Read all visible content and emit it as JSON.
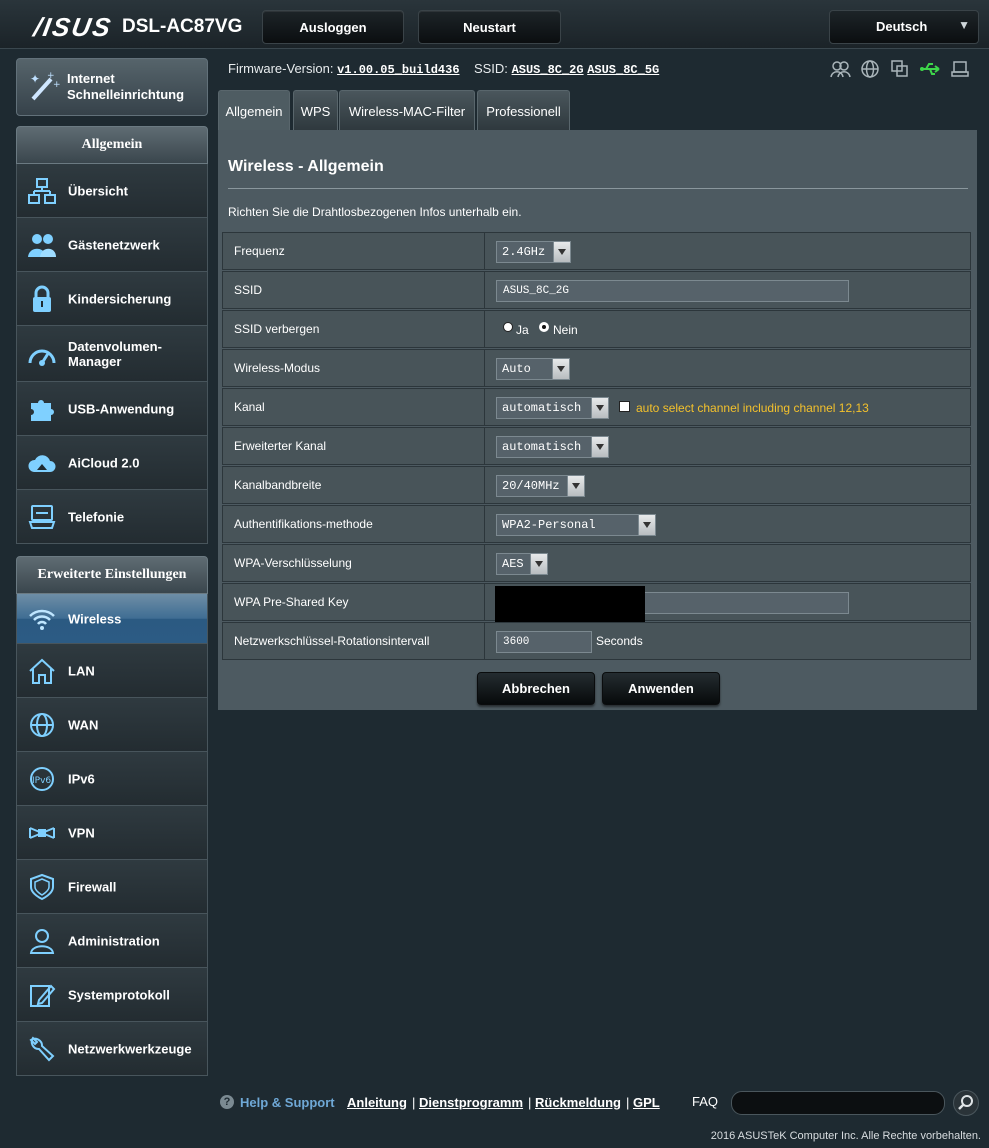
{
  "header": {
    "brand": "/ISUS",
    "model": "DSL-AC87VG",
    "logout_label": "Ausloggen",
    "reboot_label": "Neustart",
    "language": "Deutsch"
  },
  "quick_setup": {
    "label_line1": "Internet",
    "label_line2": "Schnelleinrichtung"
  },
  "sidebar": {
    "general_header": "Allgemein",
    "general_items": [
      {
        "label": "Übersicht",
        "icon": "network-map-icon"
      },
      {
        "label": "Gästenetzwerk",
        "icon": "guest-network-icon"
      },
      {
        "label": "Kindersicherung",
        "icon": "lock-icon"
      },
      {
        "label": "Datenvolumen-",
        "label2": "Manager",
        "icon": "gauge-icon"
      },
      {
        "label": "USB-Anwendung",
        "icon": "puzzle-icon"
      },
      {
        "label": "AiCloud 2.0",
        "icon": "cloud-icon"
      },
      {
        "label": "Telefonie",
        "icon": "phone-icon"
      }
    ],
    "advanced_header": "Erweiterte Einstellungen",
    "advanced_items": [
      {
        "label": "Wireless",
        "icon": "wifi-icon"
      },
      {
        "label": "LAN",
        "icon": "home-icon"
      },
      {
        "label": "WAN",
        "icon": "globe-icon"
      },
      {
        "label": "IPv6",
        "icon": "ipv6-icon"
      },
      {
        "label": "VPN",
        "icon": "vpn-icon"
      },
      {
        "label": "Firewall",
        "icon": "shield-icon"
      },
      {
        "label": "Administration",
        "icon": "admin-user-icon"
      },
      {
        "label": "Systemprotokoll",
        "icon": "log-edit-icon"
      },
      {
        "label": "Netzwerkwerkzeuge",
        "icon": "tools-icon"
      }
    ]
  },
  "status": {
    "fw_label": "Firmware-Version:",
    "fw_value": "v1.00.05_build436",
    "ssid_label": "SSID:",
    "ssid_2g": "ASUS_8C_2G",
    "ssid_5g": "ASUS_8C_5G"
  },
  "tabs": [
    "Allgemein",
    "WPS",
    "Wireless-MAC-Filter",
    "Professionell"
  ],
  "page": {
    "title": "Wireless - Allgemein",
    "description": "Richten Sie die Drahtlosbezogenen Infos unterhalb ein."
  },
  "form": {
    "frequency": {
      "label": "Frequenz",
      "value": "2.4GHz"
    },
    "ssid": {
      "label": "SSID",
      "value": "ASUS_8C_2G"
    },
    "hide_ssid": {
      "label": "SSID verbergen",
      "opt_yes": "Ja",
      "opt_no": "Nein",
      "selected": "Nein"
    },
    "wireless_mode": {
      "label": "Wireless-Modus",
      "value": "Auto"
    },
    "channel": {
      "label": "Kanal",
      "value": "automatisch",
      "hint": "auto select channel including channel 12,13"
    },
    "ext_channel": {
      "label": "Erweiterter Kanal",
      "value": "automatisch"
    },
    "bandwidth": {
      "label": "Kanalbandbreite",
      "value": "20/40MHz"
    },
    "auth": {
      "label": "Authentifikations-methode",
      "value": "WPA2-Personal"
    },
    "encryption": {
      "label": "WPA-Verschlüsselung",
      "value": "AES"
    },
    "psk": {
      "label": "WPA Pre-Shared Key",
      "value": ""
    },
    "rotation": {
      "label": "Netzwerkschlüssel-Rotationsintervall",
      "value": "3600",
      "unit": "Seconds"
    }
  },
  "actions": {
    "cancel": "Abbrechen",
    "apply": "Anwenden"
  },
  "footer": {
    "help": "Help & Support",
    "links": [
      "Anleitung",
      "Dienstprogramm",
      "Rückmeldung",
      "GPL"
    ],
    "faq": "FAQ",
    "copyright": "2016 ASUSTeK Computer Inc. Alle Rechte vorbehalten."
  },
  "colors": {
    "accent_active": "#3f6d93",
    "hint": "#f3c12c",
    "panel": "#4d5a61"
  }
}
